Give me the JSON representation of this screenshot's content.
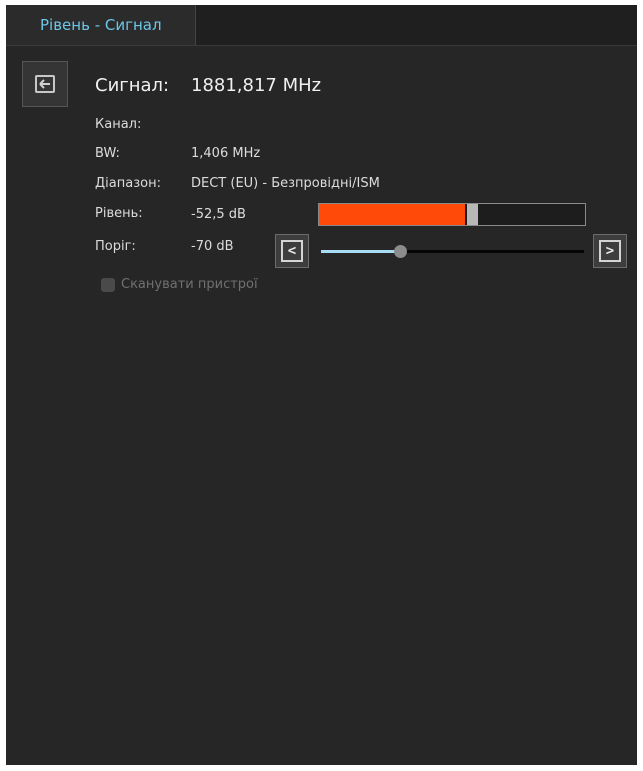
{
  "tab": {
    "label": "Рівень - Сигнал"
  },
  "back_button": {
    "icon": "back-arrow-icon"
  },
  "signal": {
    "label": "Сигнал:",
    "value": "1881,817 MHz"
  },
  "channel": {
    "label": "Канал:",
    "value": ""
  },
  "bw": {
    "label": "BW:",
    "value": "1,406 MHz"
  },
  "range": {
    "label": "Діапазон:",
    "value": "DECT (EU) - Безпровідні/ISM"
  },
  "level": {
    "label": "Рівень:",
    "value": "-52,5 dB",
    "fill_fraction": 0.55,
    "peak_fraction": 0.555,
    "fill_color": "#ff4a0a",
    "peak_color": "#b8b8b8"
  },
  "threshold": {
    "label": "Поріг:",
    "value": "-70 dB",
    "slider_fraction": 0.3,
    "decrease_icon": "chevron-left-icon",
    "increase_icon": "chevron-right-icon",
    "fill_color": "#a8dcf5"
  },
  "scan_devices": {
    "label": "Сканувати пристрої",
    "checked": false
  },
  "colors": {
    "accent": "#6cc6e8",
    "background": "#262626"
  }
}
